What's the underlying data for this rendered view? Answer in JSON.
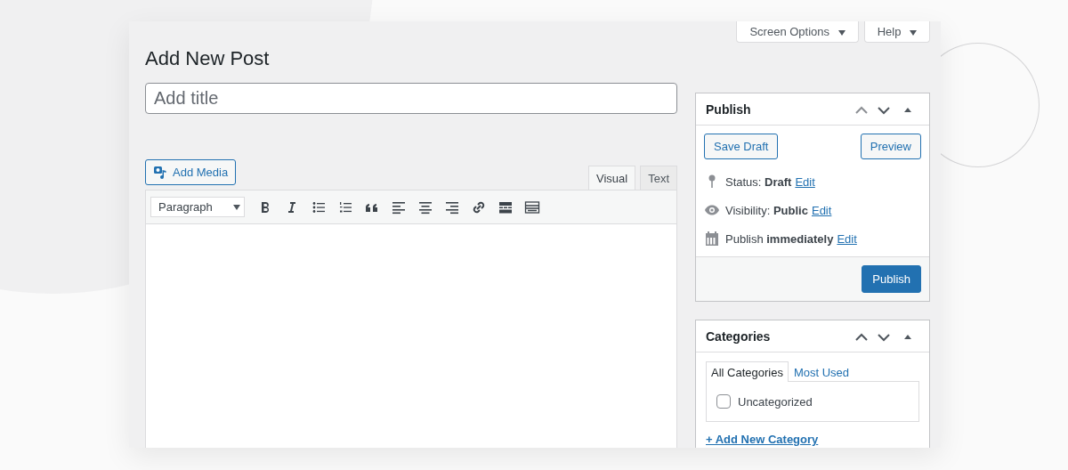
{
  "header_buttons": [
    {
      "label": "Screen Options"
    },
    {
      "label": "Help"
    }
  ],
  "page_title": "Add New Post",
  "title_field": {
    "placeholder": "Add title"
  },
  "add_media": {
    "label": "Add Media"
  },
  "editor_tabs": [
    {
      "label": "Visual",
      "selected": true
    },
    {
      "label": "Text",
      "selected": false
    }
  ],
  "format_select": {
    "value": "Paragraph"
  },
  "publish_box": {
    "title": "Publish",
    "save_draft": "Save Draft",
    "preview": "Preview",
    "rows": [
      {
        "kind": "status",
        "text": "Status: **Draft**",
        "link": "Edit"
      },
      {
        "kind": "visibility",
        "text": "Visibility: **Public**",
        "link": "Edit"
      },
      {
        "kind": "schedule",
        "text": "Publish **immediately**",
        "link": "Edit"
      }
    ],
    "publish_button": "Publish"
  },
  "categories_box": {
    "title": "Categories",
    "tabs": [
      {
        "label": "All Categories",
        "selected": true
      },
      {
        "label": "Most Used",
        "selected": false
      }
    ],
    "items": [
      {
        "label": "Uncategorized",
        "checked": false
      }
    ],
    "add_link": "+ Add New Category"
  }
}
